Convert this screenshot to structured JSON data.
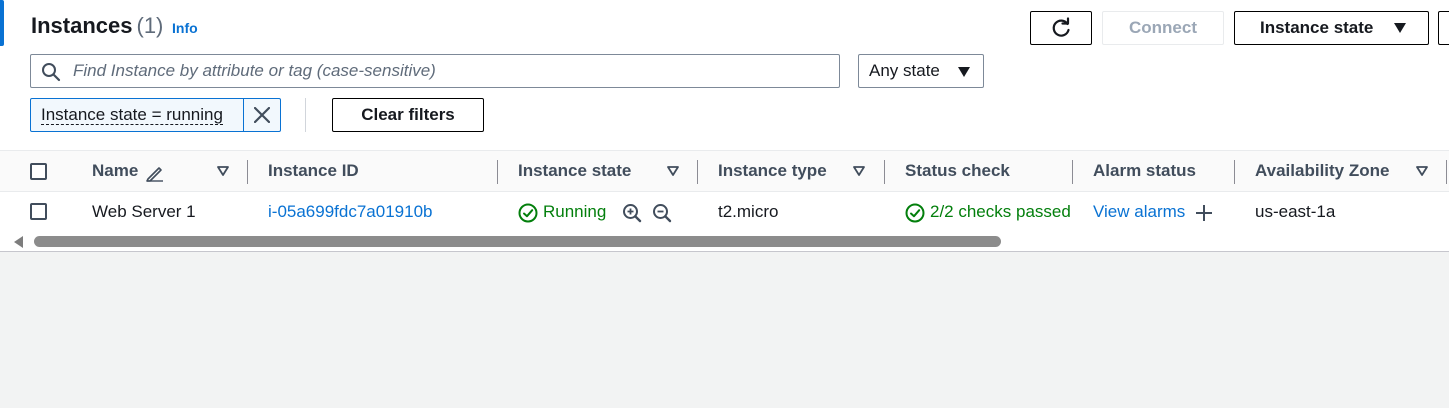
{
  "header": {
    "title": "Instances",
    "count": "(1)",
    "info_link": "Info"
  },
  "toolbar": {
    "refresh_icon": "refresh-icon",
    "connect_label": "Connect",
    "instance_state_label": "Instance state"
  },
  "search": {
    "placeholder": "Find Instance by attribute or tag (case-sensitive)",
    "value": ""
  },
  "state_filter": {
    "selected": "Any state"
  },
  "active_filter": {
    "token_label": "Instance state = running"
  },
  "clear_filters_label": "Clear filters",
  "table": {
    "columns": [
      "Name",
      "Instance ID",
      "Instance state",
      "Instance type",
      "Status check",
      "Alarm status",
      "Availability Zone"
    ],
    "rows": [
      {
        "name": "Web Server 1",
        "instance_id": "i-05a699fdc7a01910b",
        "state": "Running",
        "type": "t2.micro",
        "status_check": "2/2 checks passed",
        "alarm_link": "View alarms",
        "az": "us-east-1a"
      }
    ]
  },
  "colors": {
    "link": "#0972d3",
    "success": "#037f0c",
    "border": "#7d8998"
  }
}
